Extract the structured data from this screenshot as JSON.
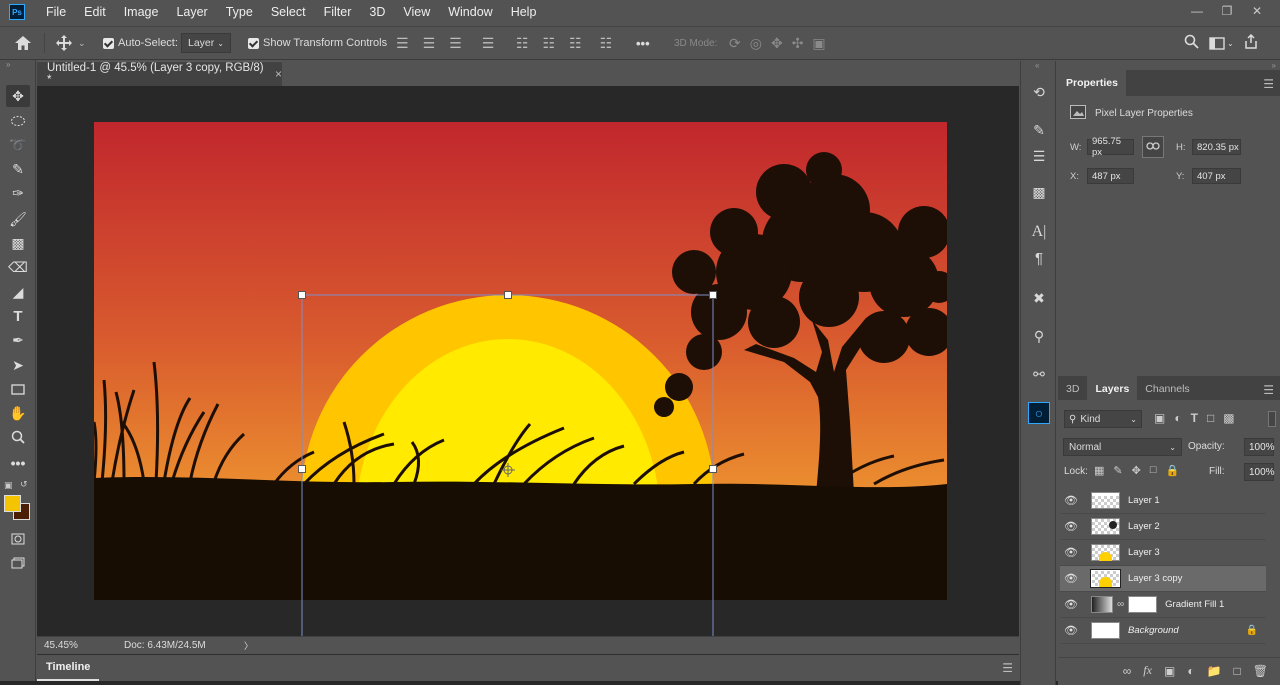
{
  "app": {
    "logo": "Ps",
    "menu": [
      "File",
      "Edit",
      "Image",
      "Layer",
      "Type",
      "Select",
      "Filter",
      "3D",
      "View",
      "Window",
      "Help"
    ],
    "window_controls": [
      "minimize-icon",
      "restore-icon",
      "close-icon"
    ]
  },
  "options_bar": {
    "home_icon": "home-icon",
    "move_tool_icon": "move-icon",
    "auto_select_label": "Auto-Select:",
    "auto_select_checked": true,
    "auto_select_target": "Layer",
    "show_transform_label": "Show Transform Controls",
    "show_transform_checked": true,
    "more_label": "•••",
    "mode_3d_label": "3D Mode:"
  },
  "document": {
    "tab_title": "Untitled-1 @ 45.5% (Layer 3 copy, RGB/8) *",
    "close_glyph": "×"
  },
  "status": {
    "zoom": "45.45%",
    "doc_size": "Doc: 6.43M/24.5M",
    "arrow": "〉"
  },
  "timeline": {
    "tab_label": "Timeline"
  },
  "tools": [
    "move-tool",
    "marquee-tool",
    "lasso-tool",
    "quick-select-tool",
    "eyedropper-tool",
    "brush-tool",
    "stamp-tool",
    "eraser-tool",
    "paint-bucket-tool",
    "type-tool",
    "pen-tool",
    "path-select-tool",
    "rectangle-tool",
    "hand-tool",
    "zoom-tool",
    "more-tools"
  ],
  "colors": {
    "foreground": "#f5c400",
    "background": "#4a1f05",
    "accent_selected_layer": "#6a6a6a",
    "sky_top": "#c1272d",
    "sky_bottom": "#f0a030",
    "sun_outer": "#ffc600",
    "sun_inner": "#ffea00",
    "ground": "#170d02"
  },
  "properties": {
    "tab_label": "Properties",
    "section_label": "Pixel Layer Properties",
    "w_label": "W:",
    "w_value": "965.75 px",
    "h_label": "H:",
    "h_value": "820.35 px",
    "x_label": "X:",
    "x_value": "487 px",
    "y_label": "Y:",
    "y_value": "407 px"
  },
  "layers_panel": {
    "tabs": [
      "3D",
      "Layers",
      "Channels"
    ],
    "active_tab": "Layers",
    "filter_label": "Kind",
    "blend_mode": "Normal",
    "opacity_label": "Opacity:",
    "opacity_value": "100%",
    "lock_label": "Lock:",
    "fill_label": "Fill:",
    "fill_value": "100%",
    "layers": [
      {
        "name": "Layer 1",
        "visible": true,
        "selected": false
      },
      {
        "name": "Layer 2",
        "visible": true,
        "selected": false
      },
      {
        "name": "Layer 3",
        "visible": true,
        "selected": false
      },
      {
        "name": "Layer 3 copy",
        "visible": true,
        "selected": true
      },
      {
        "name": "Gradient Fill 1",
        "visible": true,
        "selected": false
      },
      {
        "name": "Background",
        "visible": true,
        "selected": false,
        "locked": true
      }
    ],
    "footer_icons": [
      "link-icon",
      "fx-icon",
      "mask-icon",
      "adjustment-icon",
      "group-icon",
      "new-layer-icon",
      "trash-icon"
    ]
  }
}
